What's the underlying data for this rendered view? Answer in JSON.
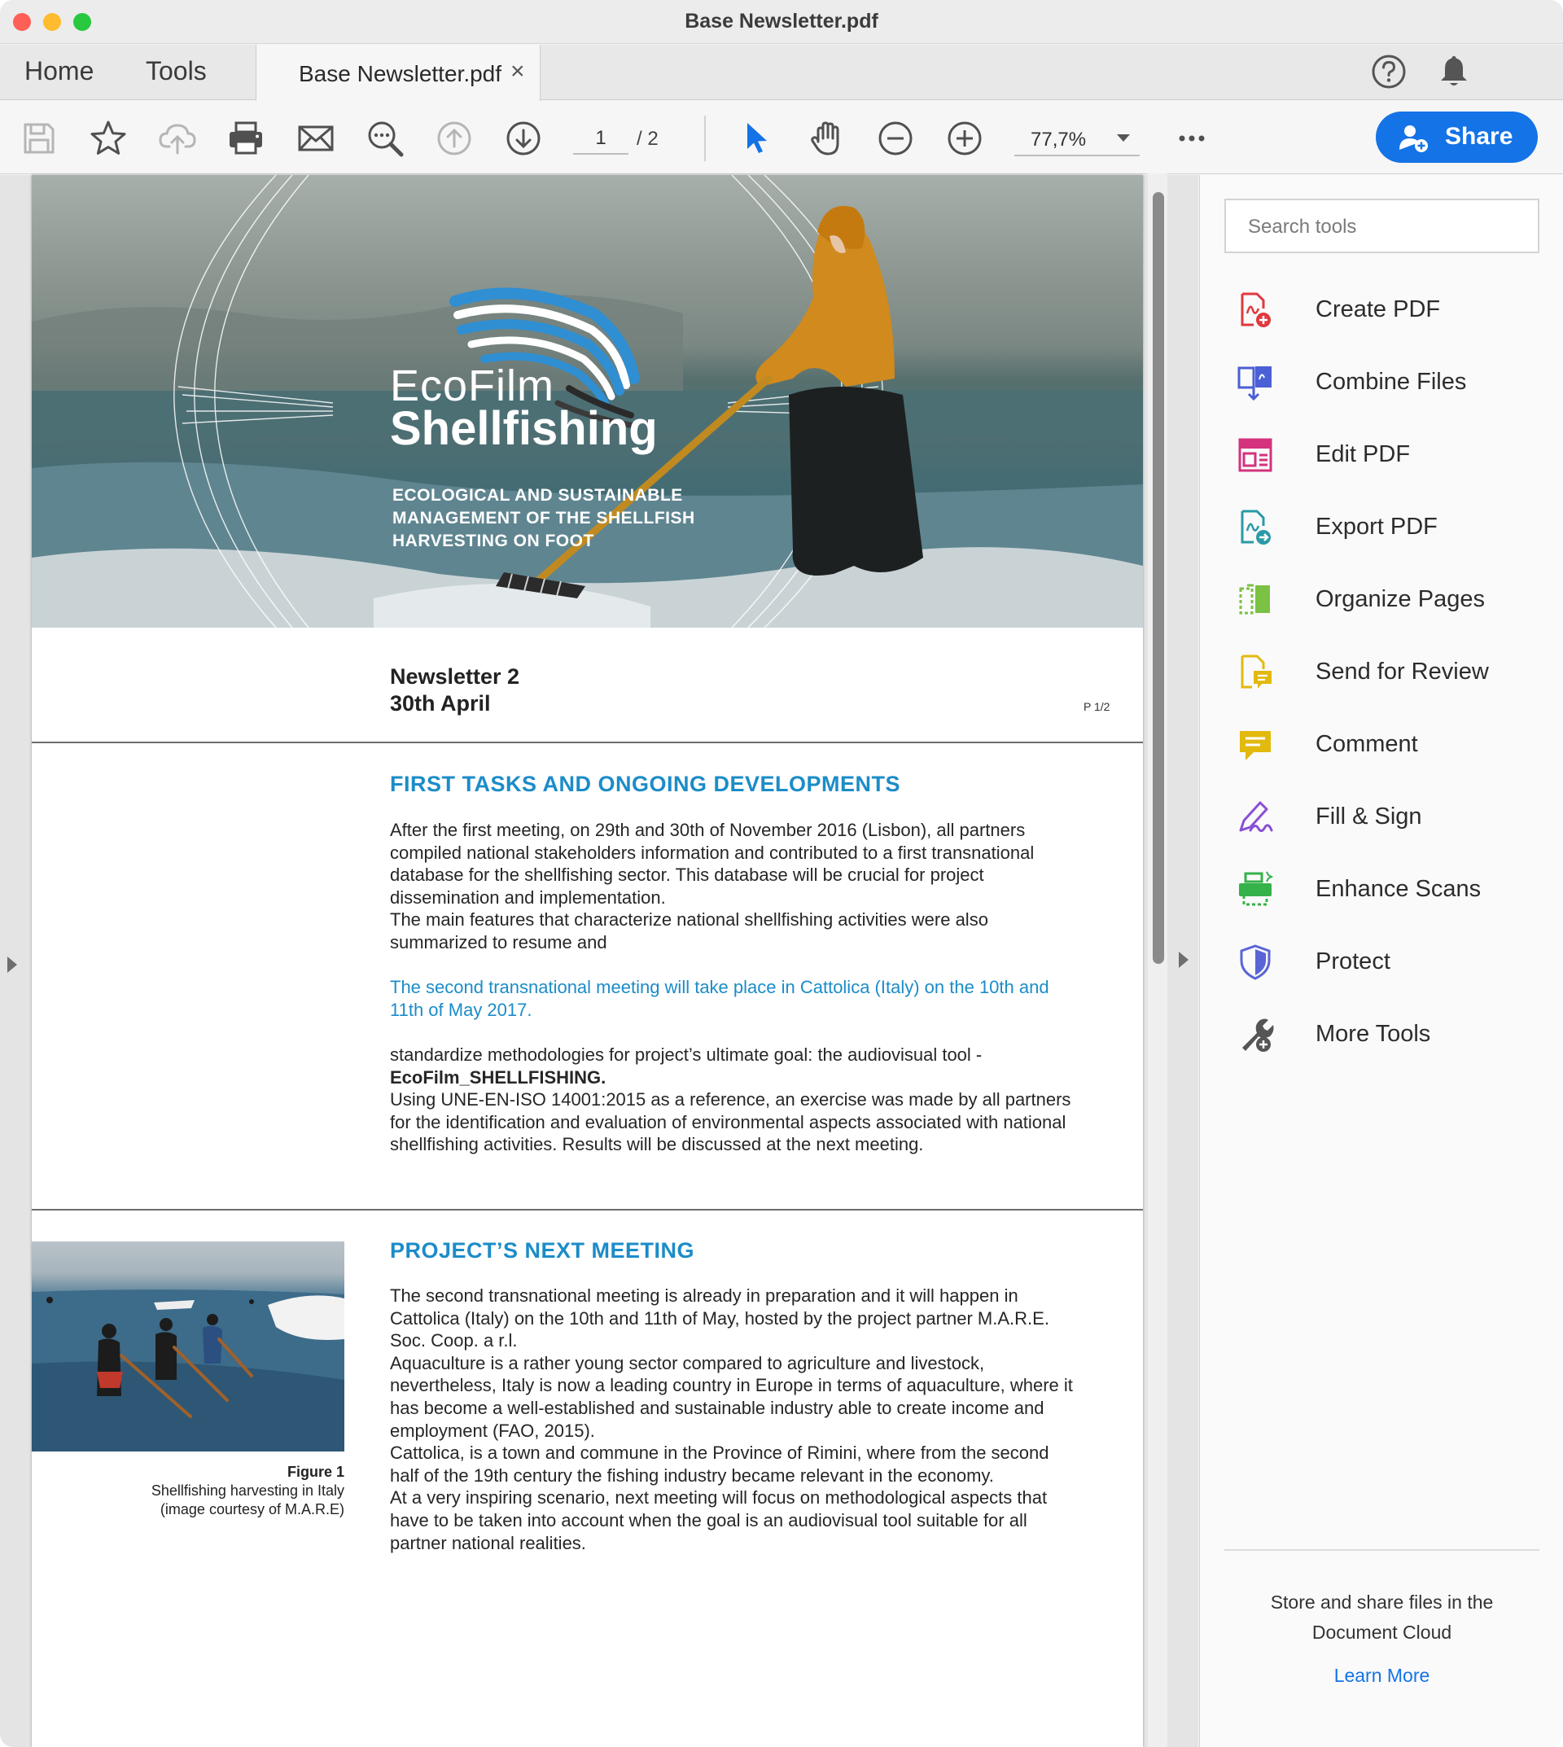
{
  "window": {
    "title": "Base Newsletter.pdf"
  },
  "tabs": {
    "home": "Home",
    "tools": "Tools",
    "document": "Base Newsletter.pdf",
    "close_glyph": "×"
  },
  "toolbar": {
    "page_current": "1",
    "page_total": "/ 2",
    "zoom": "77,7%",
    "share_label": "Share",
    "icons": [
      "save-icon",
      "bookmark-star-icon",
      "cloud-upload-icon",
      "print-icon",
      "email-icon",
      "find-zoom-icon",
      "page-up-icon",
      "page-down-icon",
      "select-arrow-icon",
      "hand-tool-icon",
      "zoom-out-icon",
      "zoom-in-icon",
      "more-options-icon"
    ]
  },
  "document": {
    "banner": {
      "logo_line1": "EcoFilm",
      "logo_line2": "Shellfishing",
      "subtitle": "ECOLOGICAL AND SUSTAINABLE MANAGEMENT OF THE SHELLFISH HARVESTING ON FOOT"
    },
    "newsletter_title": "Newsletter 2",
    "newsletter_date": "30th April",
    "page_marker": "P 1/2",
    "section1": {
      "heading": "FIRST TASKS AND ONGOING DEVELOPMENTS",
      "para1": "After the first meeting, on 29th and 30th of November 2016 (Lisbon), all partners compiled national stakeholders information and contributed to a first transnational database for the shellfishing sector. This database will be crucial for project dissemination and implementation.",
      "para2": "The main features that characterize national shellfishing activities were also summarized to resume and",
      "highlight": "The second transnational meeting will take place in Cattolica (Italy) on the 10th and 11th of May 2017.",
      "para3": "standardize methodologies for project’s ultimate goal:  the audiovisual tool -",
      "para3_bold": "EcoFilm_SHELLFISHING.",
      "para4": "Using UNE-EN-ISO 14001:2015 as a reference, an exercise was made by all partners for the identification and evaluation of environmental aspects associated with national shellfishing activities. Results will be discussed at the next meeting."
    },
    "section2": {
      "heading": "PROJECT’S NEXT MEETING",
      "para1": "The second transnational meeting is already in preparation and it will happen in Cattolica (Italy) on the 10th and 11th of May, hosted by the project partner M.A.R.E. Soc. Coop. a r.l.",
      "para2": "Aquaculture is a rather young sector compared to agriculture and livestock, nevertheless, Italy is now a leading country in Europe in terms of aquaculture, where it has become a well-established and sustainable industry able to create income and employment  (FAO, 2015).",
      "para3": "Cattolica, is a town and commune in the Province of Rimini, where from the second half of the 19th century the fishing industry became relevant in the economy.",
      "para4": "At a very inspiring scenario, next meeting will focus on methodological aspects that have to be taken into account when the goal is an audiovisual tool suitable for all partner national realities."
    },
    "figure": {
      "label": "Figure 1",
      "caption_line1": "Shellfishing harvesting in Italy",
      "caption_line2": "(image courtesy of M.A.R.E)"
    }
  },
  "tools_pane": {
    "search_placeholder": "Search tools",
    "items": [
      {
        "label": "Create PDF",
        "icon": "create-pdf-icon",
        "color": "#e0393e"
      },
      {
        "label": "Combine Files",
        "icon": "combine-files-icon",
        "color": "#4b5fd6"
      },
      {
        "label": "Edit PDF",
        "icon": "edit-pdf-icon",
        "color": "#d4317e"
      },
      {
        "label": "Export PDF",
        "icon": "export-pdf-icon",
        "color": "#2b9aa6"
      },
      {
        "label": "Organize Pages",
        "icon": "organize-pages-icon",
        "color": "#7bc143"
      },
      {
        "label": "Send for Review",
        "icon": "send-for-review-icon",
        "color": "#e2b90f"
      },
      {
        "label": "Comment",
        "icon": "comment-icon",
        "color": "#e2b90f"
      },
      {
        "label": "Fill & Sign",
        "icon": "fill-sign-icon",
        "color": "#8a4fd6"
      },
      {
        "label": "Enhance Scans",
        "icon": "enhance-scans-icon",
        "color": "#35b24a"
      },
      {
        "label": "Protect",
        "icon": "protect-icon",
        "color": "#5a64d6"
      },
      {
        "label": "More Tools",
        "icon": "more-tools-icon",
        "color": "#555555"
      }
    ],
    "cloud_line1": "Store and share files in the",
    "cloud_line2": "Document Cloud",
    "learn_more": "Learn More"
  },
  "colors": {
    "accent": "#1473e6",
    "heading_blue": "#1c8cc8"
  }
}
